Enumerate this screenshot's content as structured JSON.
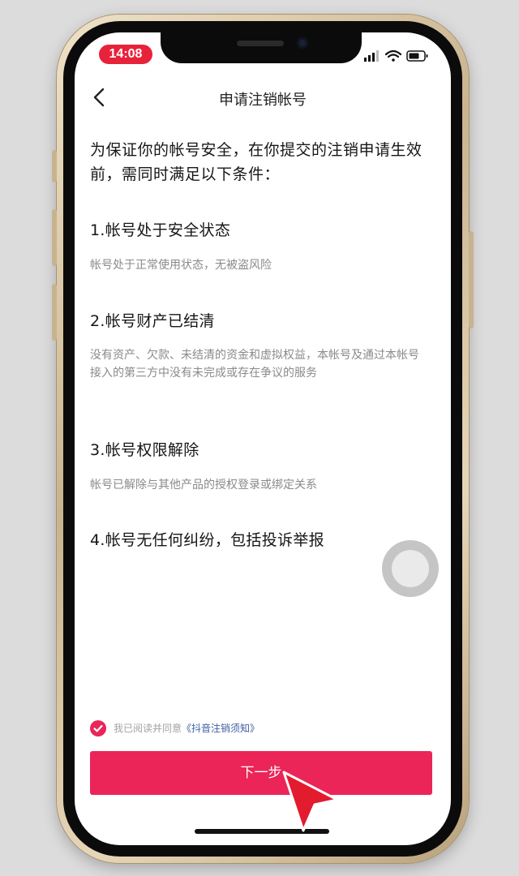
{
  "status_bar": {
    "time": "14:08"
  },
  "nav": {
    "title": "申请注销帐号"
  },
  "intro": "为保证你的帐号安全，在你提交的注销申请生效前，需同时满足以下条件：",
  "conditions": [
    {
      "title": "1.帐号处于安全状态",
      "desc": "帐号处于正常使用状态，无被盗风险"
    },
    {
      "title": "2.帐号财产已结清",
      "desc": "没有资产、欠款、未结清的资金和虚拟权益，本帐号及通过本帐号接入的第三方中没有未完成或存在争议的服务"
    },
    {
      "title": "3.帐号权限解除",
      "desc": "帐号已解除与其他产品的授权登录或绑定关系"
    },
    {
      "title": "4.帐号无任何纠纷，包括投诉举报",
      "desc": ""
    }
  ],
  "agreement": {
    "text": "我已阅读并同意",
    "link": "《抖音注销须知》",
    "checked": true
  },
  "next_button": {
    "label": "下一步"
  },
  "colors": {
    "accent": "#eb2557",
    "time_pill": "#e7223a",
    "link": "#3f5ea3"
  }
}
